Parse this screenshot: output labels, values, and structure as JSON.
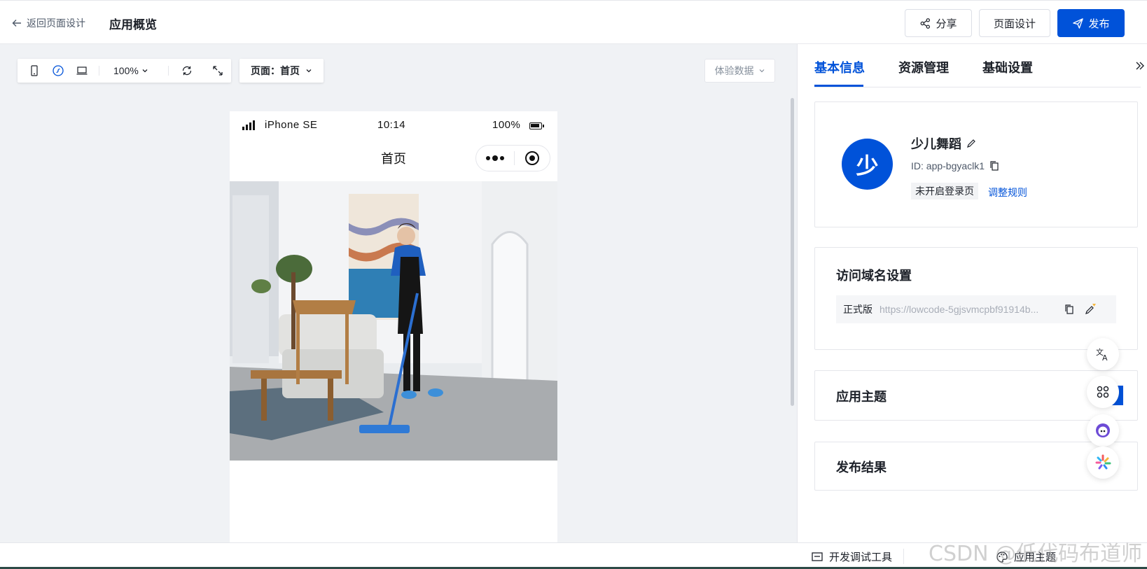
{
  "header": {
    "back_label": "返回页面设计",
    "title": "应用概览",
    "share_label": "分享",
    "design_label": "页面设计",
    "publish_label": "发布"
  },
  "canvas_toolbar": {
    "zoom": "100%",
    "page_label": "页面：",
    "page_value": "首页",
    "experience_data": "体验数据"
  },
  "phone": {
    "carrier": "iPhone SE",
    "time": "10:14",
    "battery": "100%",
    "nav_title": "首页"
  },
  "panel": {
    "tabs": [
      "基本信息",
      "资源管理",
      "基础设置"
    ],
    "active_tab": 0,
    "app": {
      "avatar_char": "少",
      "name": "少儿舞蹈",
      "id_text": "ID: app-bgyaclk1",
      "login_status": "未开启登录页",
      "rule_link": "调整规则"
    },
    "domain": {
      "title": "访问域名设置",
      "tag": "正式版",
      "url": "https://lowcode-5gjsvmcpbf91914b..."
    },
    "theme": {
      "title": "应用主题"
    },
    "publish_result": {
      "title": "发布结果"
    }
  },
  "bottombar": {
    "dev_tools": "开发调试工具",
    "app_theme": "应用主题"
  },
  "watermark": "CSDN @低代码布道师",
  "colors": {
    "primary": "#0052d9",
    "canvas_bg": "#f0f2f5",
    "text": "#1d2129",
    "muted": "#86909c"
  }
}
